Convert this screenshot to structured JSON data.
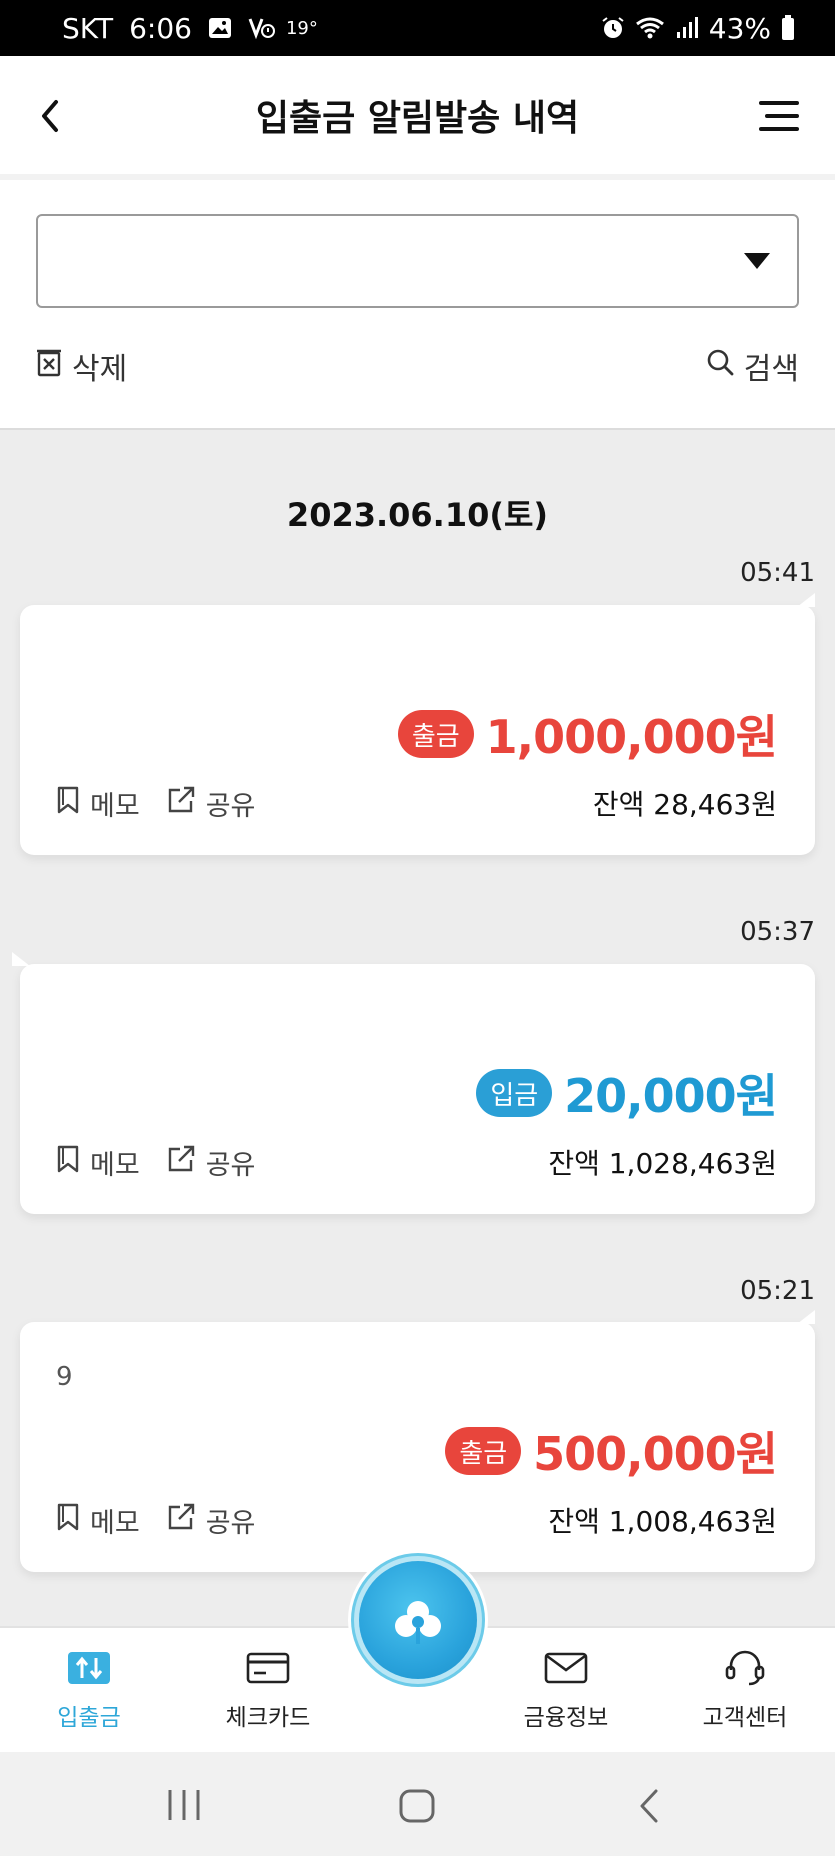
{
  "status_bar": {
    "carrier": "SKT",
    "time": "6:06",
    "temperature": "19°",
    "battery": "43%"
  },
  "header": {
    "title": "입출금 알림발송 내역"
  },
  "filter": {
    "account_value": "",
    "delete_label": "삭제",
    "search_label": "검색"
  },
  "list": {
    "date": "2023.06.10(토)",
    "transactions": [
      {
        "time": "05:41",
        "description": "",
        "type_label": "출금",
        "type": "out",
        "amount": "1,000,000원",
        "balance": "잔액 28,463원",
        "memo_label": "메모",
        "share_label": "공유"
      },
      {
        "time": "05:37",
        "description": "",
        "type_label": "입금",
        "type": "in",
        "amount": "20,000원",
        "balance": "잔액 1,028,463원",
        "memo_label": "메모",
        "share_label": "공유"
      },
      {
        "time": "05:21",
        "description": "9",
        "type_label": "출금",
        "type": "out",
        "amount": "500,000원",
        "balance": "잔액 1,008,463원",
        "memo_label": "메모",
        "share_label": "공유"
      }
    ]
  },
  "bottom_nav": {
    "items": [
      {
        "label": "입출금",
        "icon": "transfer-icon",
        "active": true
      },
      {
        "label": "체크카드",
        "icon": "card-icon",
        "active": false
      },
      {
        "label": "금융정보",
        "icon": "mail-icon",
        "active": false
      },
      {
        "label": "고객센터",
        "icon": "headset-icon",
        "active": false
      }
    ],
    "center_icon": "cloud-logo-icon"
  },
  "colors": {
    "withdraw": "#e8453c",
    "deposit": "#1f9ad3",
    "accent": "#2ea7d8"
  }
}
